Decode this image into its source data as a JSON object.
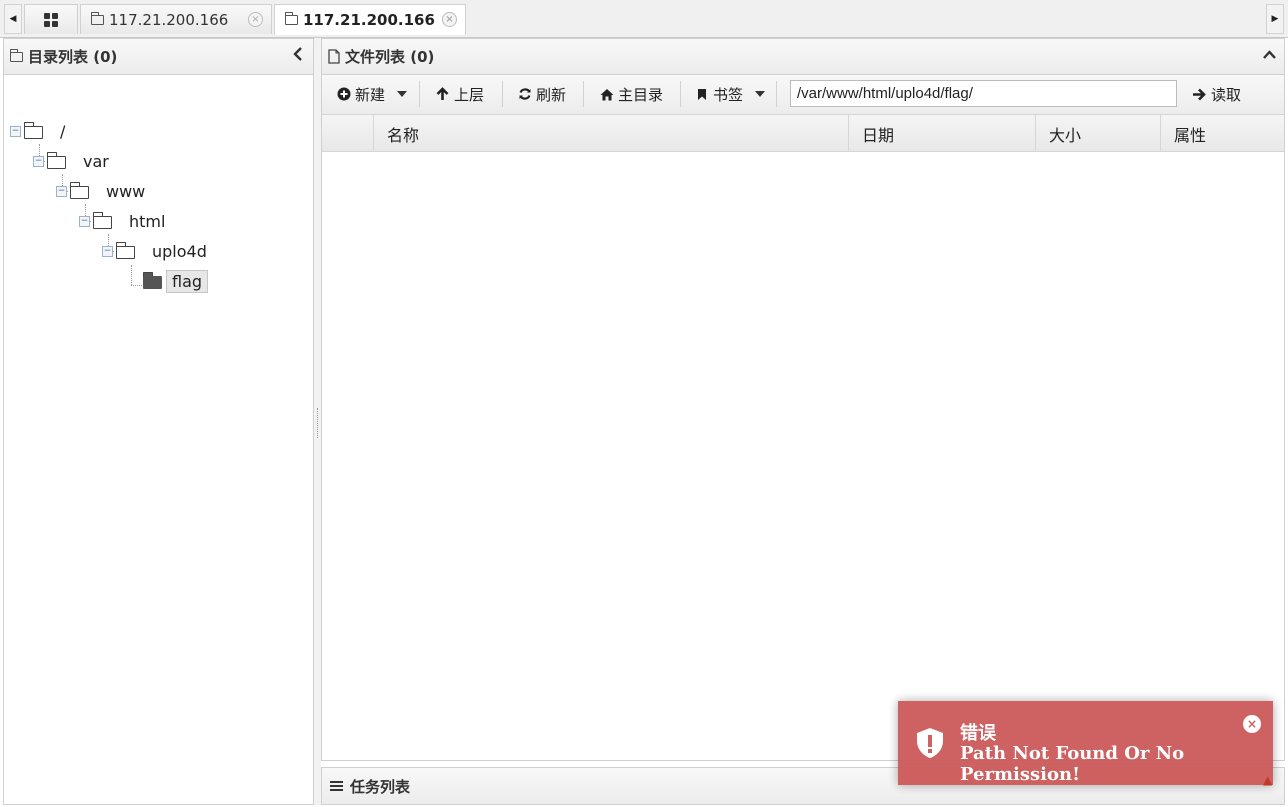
{
  "tabs": [
    {
      "label": "117.21.200.166",
      "active": false
    },
    {
      "label": "117.21.200.166",
      "active": true
    }
  ],
  "tab_close_glyph": "×",
  "dir_panel": {
    "title": "目录列表 (0)",
    "tree": [
      "/",
      "var",
      "www",
      "html",
      "uplo4d",
      "flag"
    ],
    "selected": "flag"
  },
  "file_panel": {
    "title": "文件列表 (0)",
    "toolbar": {
      "new_label": "新建",
      "up_label": "上层",
      "refresh_label": "刷新",
      "home_label": "主目录",
      "bookmark_label": "书签",
      "path_value": "/var/www/html/uplo4d/flag/",
      "read_label": "读取"
    },
    "columns": [
      "名称",
      "日期",
      "大小",
      "属性"
    ],
    "rows": []
  },
  "task_panel": {
    "title": "任务列表"
  },
  "toast": {
    "title": "错误",
    "message": "Path Not Found Or No Permission!",
    "color": "#cd5c5c"
  },
  "icons": [
    "grid-icon",
    "folder-icon",
    "close-icon",
    "chevron-left-icon",
    "chevron-up-icon",
    "plus-circle-icon",
    "arrow-up-icon",
    "refresh-icon",
    "home-icon",
    "bookmark-icon",
    "arrow-right-icon",
    "list-icon",
    "shield-icon"
  ]
}
